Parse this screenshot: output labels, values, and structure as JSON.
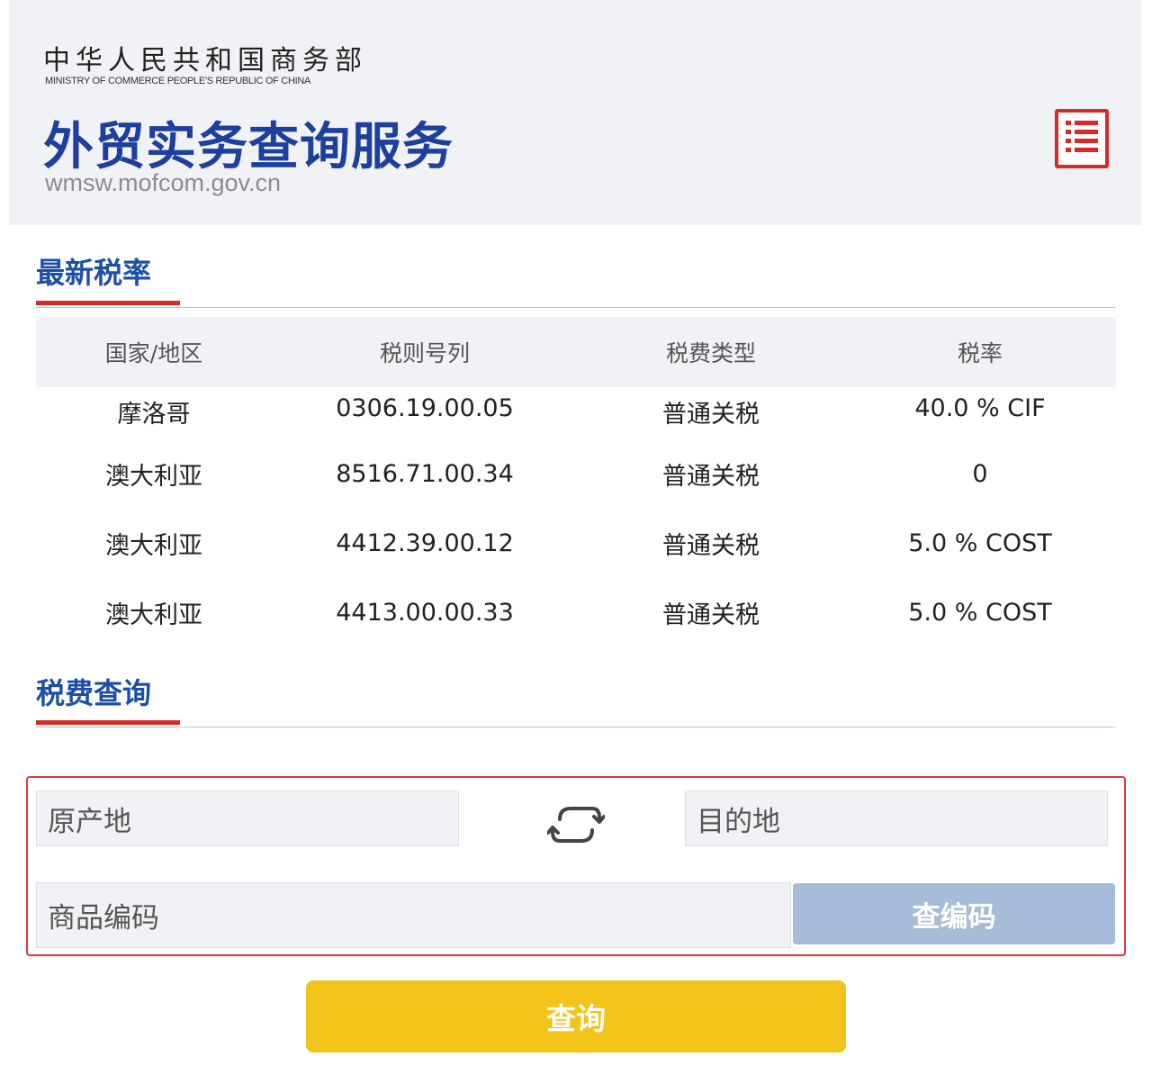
{
  "header": {
    "ministry_cn": "中华人民共和国商务部",
    "ministry_en": "MINISTRY OF COMMERCE PEOPLE'S REPUBLIC OF CHINA",
    "app_title": "外贸实务查询服务",
    "app_url": "wmsw.mofcom.gov.cn",
    "menu_icon": "list-menu-icon"
  },
  "latest_rates": {
    "title": "最新税率",
    "columns": [
      "国家/地区",
      "税则号列",
      "税费类型",
      "税率"
    ],
    "rows": [
      {
        "country": "摩洛哥",
        "code": "0306.19.00.05",
        "type": "普通关税",
        "rate": "40.0 % CIF"
      },
      {
        "country": "澳大利亚",
        "code": "8516.71.00.34",
        "type": "普通关税",
        "rate": "0"
      },
      {
        "country": "澳大利亚",
        "code": "4412.39.00.12",
        "type": "普通关税",
        "rate": "5.0 % COST"
      },
      {
        "country": "澳大利亚",
        "code": "4413.00.00.33",
        "type": "普通关税",
        "rate": "5.0 % COST"
      }
    ]
  },
  "tax_query": {
    "title": "税费查询",
    "origin_placeholder": "原产地",
    "destination_placeholder": "目的地",
    "swap_icon": "swap-icon",
    "product_code_placeholder": "商品编码",
    "lookup_code_label": "查编码",
    "query_label": "查询"
  },
  "colors": {
    "brand_blue": "#1d3f9e",
    "accent_red": "#d42a2a",
    "query_yellow": "#f2c318",
    "lookup_button": "#a6bcd8"
  }
}
